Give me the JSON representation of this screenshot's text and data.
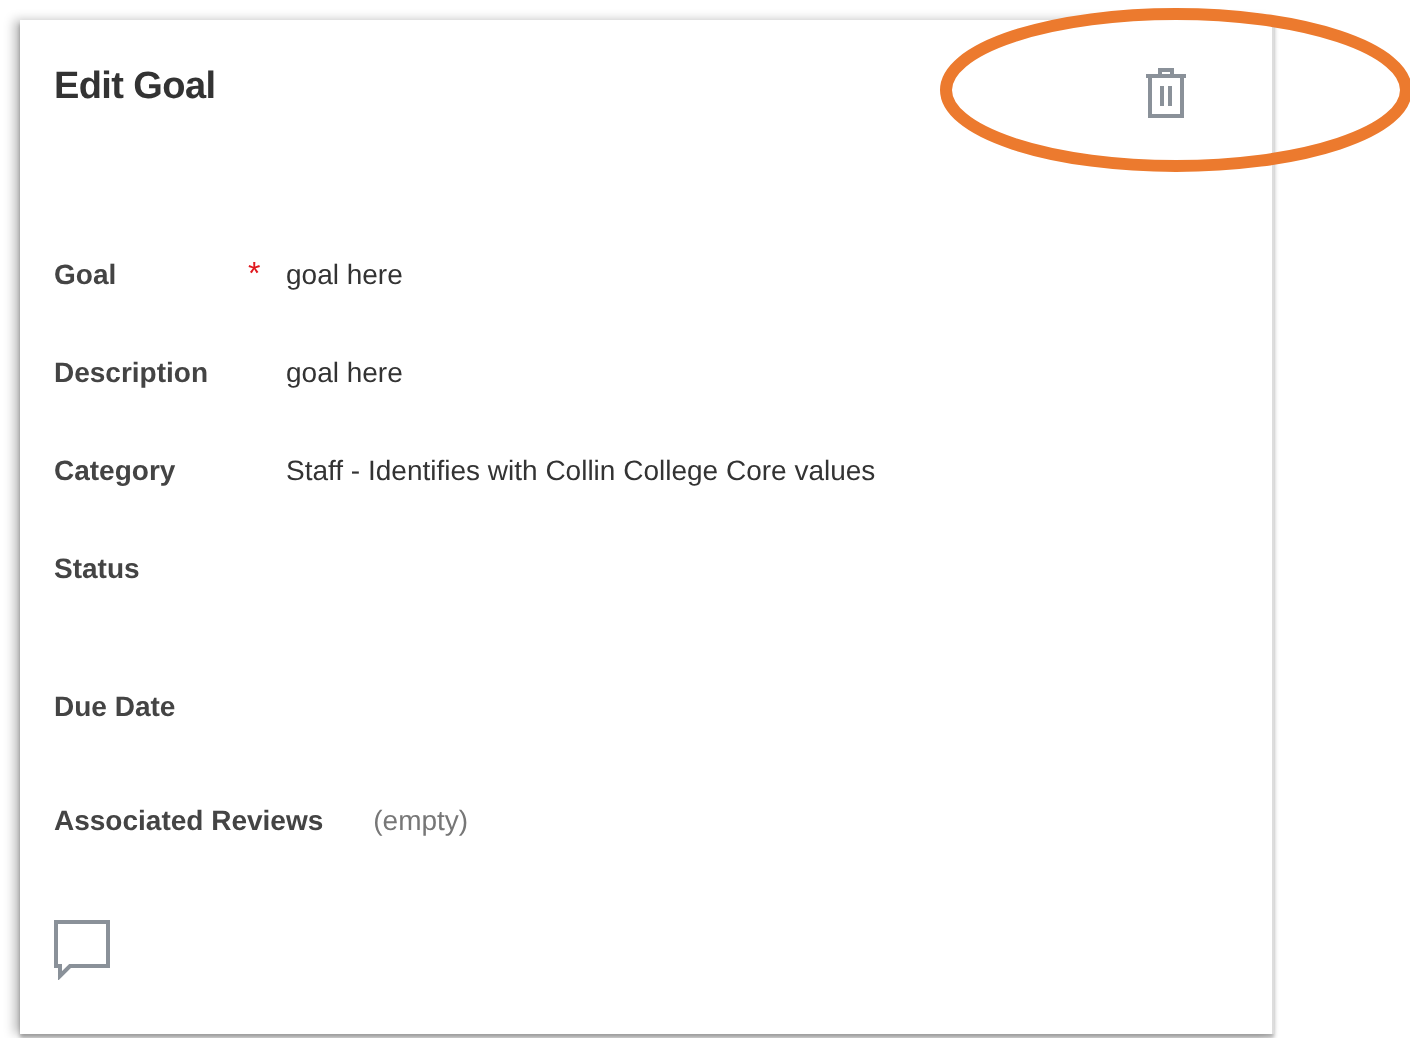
{
  "title": "Edit Goal",
  "fields": [
    {
      "label": "Goal",
      "required_mark": "*",
      "kind": "value",
      "value": "goal here"
    },
    {
      "label": "Description",
      "kind": "value",
      "value": "goal here"
    },
    {
      "label": "Category",
      "kind": "value",
      "value": "Staff - Identifies with Collin College Core values"
    },
    {
      "label": "Status",
      "kind": "blank"
    },
    {
      "label": "Due Date",
      "kind": "blank"
    },
    {
      "label": "Associated Reviews",
      "kind": "empty",
      "value": "(empty)"
    }
  ]
}
